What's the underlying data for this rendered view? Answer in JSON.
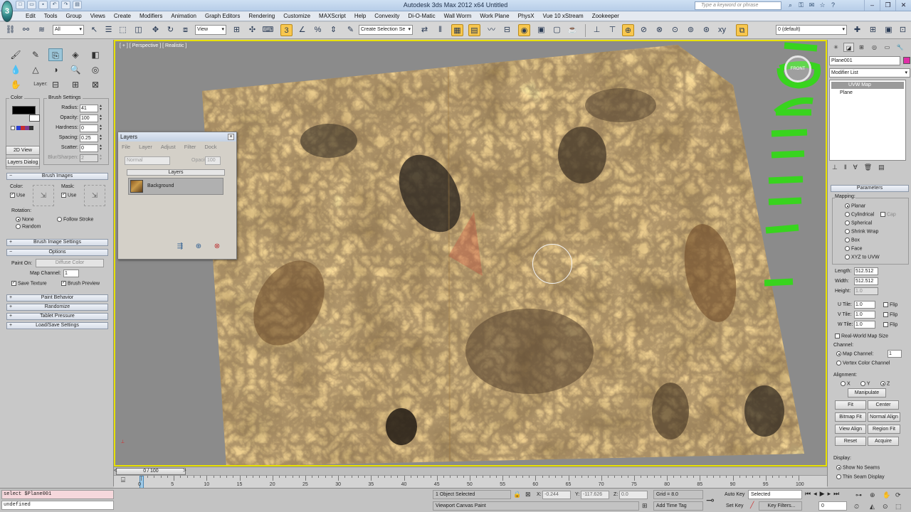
{
  "app": {
    "title": "Autodesk 3ds Max 2012 x64      Untitled",
    "logo": "3",
    "search_placeholder": "Type a keyword or phrase",
    "quick_access_icons": [
      "new-icon",
      "open-icon",
      "save-icon",
      "undo-icon",
      "redo-icon",
      "project-folder-icon"
    ],
    "window_controls": [
      "minimize",
      "restore",
      "close"
    ]
  },
  "menu": [
    "Edit",
    "Tools",
    "Group",
    "Views",
    "Create",
    "Modifiers",
    "Animation",
    "Graph Editors",
    "Rendering",
    "Customize",
    "MAXScript",
    "Help",
    "Convexity",
    "Di-O-Matic",
    "Wall Worm",
    "Work Plane",
    "PhysX",
    "Vue 10 xStream",
    "Zookeeper"
  ],
  "toolbar": {
    "selection_filter": "All",
    "ref_coord": "View",
    "named_selection": "Create Selection Se",
    "layer": "0 (default)"
  },
  "viewport_paint": {
    "layer_label": "Layer:",
    "color_group_title": "Color",
    "view_2d_button": "2D View",
    "layers_dialog_button": "Layers Dialog",
    "brush_settings": {
      "title": "Brush Settings",
      "rows": [
        {
          "label": "Radius:",
          "value": "41",
          "enabled": true
        },
        {
          "label": "Opacity:",
          "value": "100",
          "enabled": true
        },
        {
          "label": "Hardness:",
          "value": "0",
          "enabled": true
        },
        {
          "label": "Spacing:",
          "value": "0.25",
          "enabled": true
        },
        {
          "label": "Scatter:",
          "value": "0",
          "enabled": true
        },
        {
          "label": "Blur/Sharpen:",
          "value": "2",
          "enabled": false
        }
      ]
    },
    "brush_images": {
      "title": "Brush Images",
      "color_label": "Color:",
      "mask_label": "Mask:",
      "use_label": "Use",
      "rotation_title": "Rotation:",
      "rot_none": "None",
      "rot_random": "Random",
      "rot_follow": "Follow Stroke"
    },
    "brush_image_settings": "Brush Image Settings",
    "options": {
      "title": "Options",
      "paint_on_label": "Paint On:",
      "paint_on_value": "Diffuse Color",
      "map_channel_label": "Map Channel:",
      "map_channel_value": "1",
      "save_texture": "Save Texture",
      "brush_preview": "Brush Preview"
    },
    "rollouts": [
      "Paint Behavior",
      "Randomize",
      "Tablet Pressure",
      "Load/Save Settings"
    ]
  },
  "viewport": {
    "label": "[ + ] [ Perspective ] [ Realistic ]",
    "gizmo_text": "FRONT"
  },
  "layers_dialog": {
    "title": "Layers",
    "menu": [
      "File",
      "Layer",
      "Adjust",
      "Filter",
      "Dock"
    ],
    "blend_mode": "Normal",
    "opacity_label": "Opacity:",
    "opacity_value": "100",
    "layers_header": "Layers",
    "layers": [
      {
        "name": "Background"
      }
    ]
  },
  "command_panel": {
    "object_name": "Plane001",
    "object_color": "#e02ea7",
    "modifier_list": "Modifier List",
    "stack": [
      "UVW Map",
      "Plane"
    ],
    "parameters_title": "Parameters",
    "mapping_title": "Mapping:",
    "mapping_options": [
      "Planar",
      "Cylindrical",
      "Spherical",
      "Shrink Wrap",
      "Box",
      "Face",
      "XYZ to UVW"
    ],
    "mapping_selected": "Planar",
    "cap_label": "Cap",
    "length_label": "Length:",
    "length_value": "512.512",
    "width_label": "Width:",
    "width_value": "512.512",
    "height_label": "Height:",
    "height_value": "1.0",
    "u_tile_label": "U Tile:",
    "u_tile_value": "1.0",
    "v_tile_label": "V Tile:",
    "v_tile_value": "1.0",
    "w_tile_label": "W Tile:",
    "w_tile_value": "1.0",
    "flip_label": "Flip",
    "real_world": "Real-World Map Size",
    "channel_title": "Channel:",
    "map_channel_label": "Map Channel:",
    "map_channel_value": "1",
    "vertex_color_channel": "Vertex Color Channel",
    "alignment_title": "Alignment:",
    "axes": [
      "X",
      "Y",
      "Z"
    ],
    "axis_selected": "Z",
    "manipulate": "Manipulate",
    "fit": "Fit",
    "center": "Center",
    "bitmap_fit": "Bitmap Fit",
    "normal_align": "Normal Align",
    "view_align": "View Align",
    "region_fit": "Region Fit",
    "reset": "Reset",
    "acquire": "Acquire",
    "display_title": "Display:",
    "show_no_seams": "Show No Seams",
    "thin_seam": "Thin Seam Display"
  },
  "timeline": {
    "frame_display": "0 / 100",
    "ticks": [
      "0",
      "5",
      "10",
      "15",
      "20",
      "25",
      "30",
      "35",
      "40",
      "45",
      "50",
      "55",
      "60",
      "65",
      "70",
      "75",
      "80",
      "85",
      "90",
      "95",
      "100"
    ]
  },
  "status": {
    "maxscript_input": "select $Plane001",
    "maxscript_output": "undefined",
    "selection_info": "1 Object Selected",
    "prompt": "Viewport Canvas Paint",
    "x_label": "X:",
    "x_value": "-0.244",
    "y_label": "Y:",
    "y_value": "-117.626",
    "z_label": "Z:",
    "z_value": "0.0",
    "grid": "Grid = 8.0",
    "auto_key": "Auto Key",
    "set_key": "Set Key",
    "key_mode": "Selected",
    "key_filters": "Key Filters...",
    "current_frame": "0",
    "add_time_tag": "Add Time Tag"
  }
}
